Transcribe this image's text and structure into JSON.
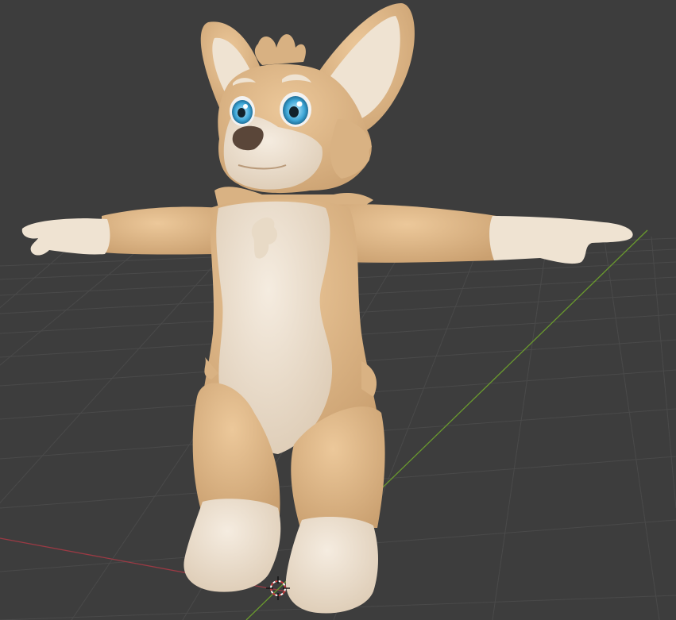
{
  "viewport": {
    "background_color": "#3d3d3d",
    "grid_color": "#4b4b4b",
    "x_axis_color": "#9b3a44",
    "y_axis_color": "#6a9a2e",
    "cursor_icon": "3d-cursor-icon"
  },
  "model": {
    "fur_primary_color": "#e2bd8f",
    "fur_shadow_color": "#c99f72",
    "fur_light_color": "#efe3d2",
    "eye_iris_color": "#3fa8d8",
    "nose_color": "#5a4639"
  }
}
